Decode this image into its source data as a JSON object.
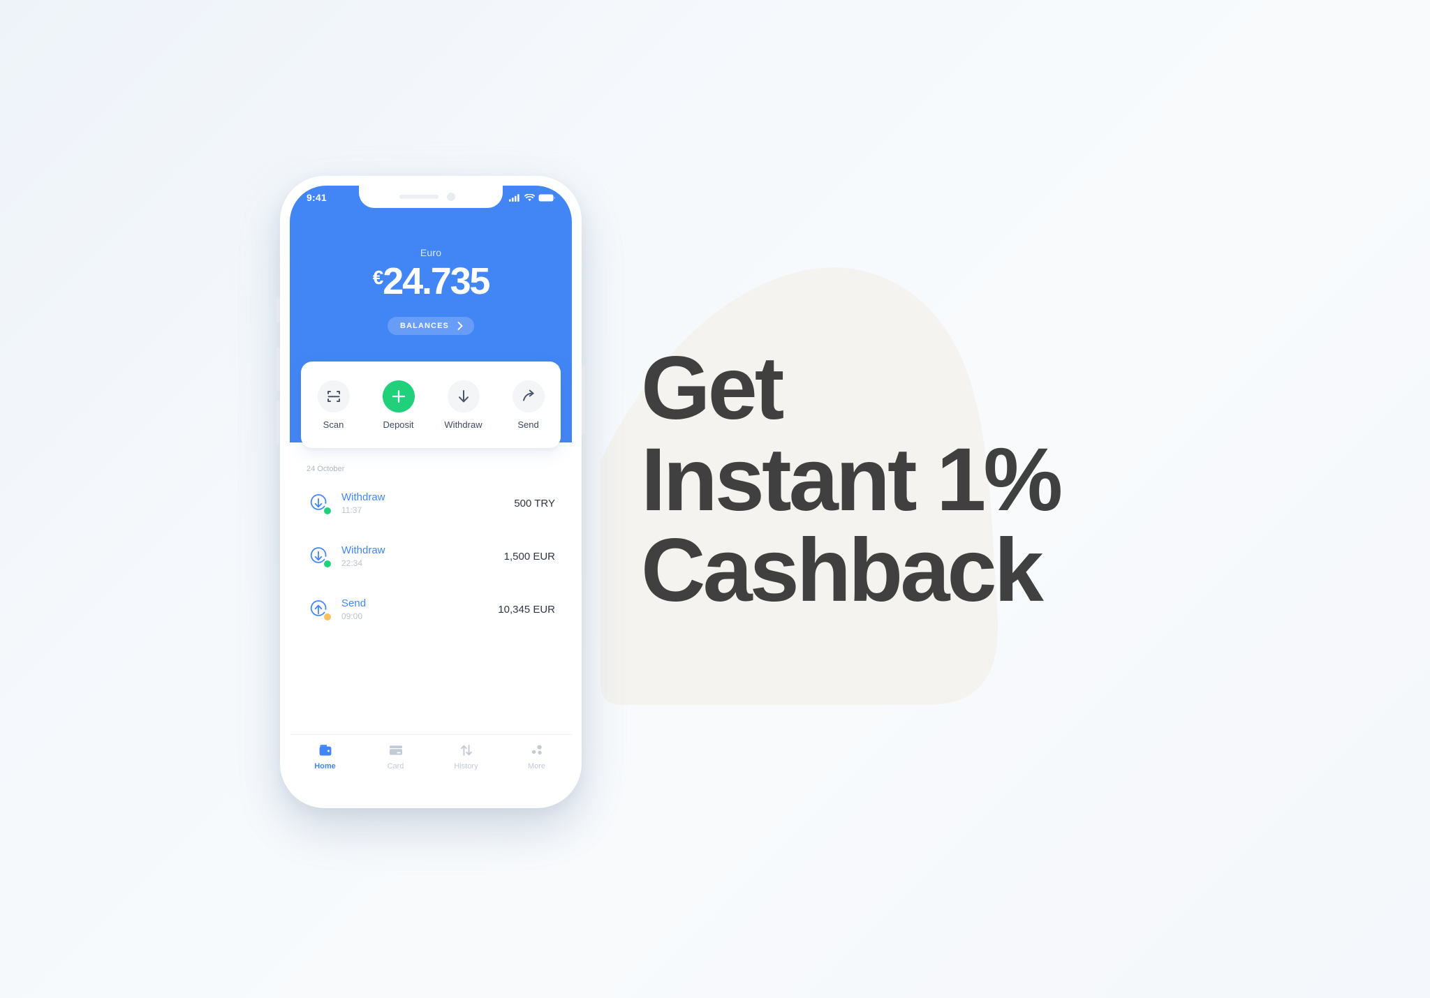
{
  "theme": {
    "brand_blue": "#4285f4",
    "accent_green": "#21d07a",
    "status_pending": "#f8c15c",
    "status_done": "#21d07a",
    "headline_color": "#404040",
    "blob_color": "#f4f3f0",
    "page_background": "#f5f8fb"
  },
  "phone": {
    "status_bar": {
      "time": "9:41",
      "icons": [
        "cellular-signal-icon",
        "wifi-icon",
        "battery-icon"
      ]
    },
    "header": {
      "currency_label": "Euro",
      "currency_symbol": "€",
      "balance_amount": "24.735",
      "balances_button": {
        "label": "BALANCES",
        "icon": "chevron-right-icon"
      }
    },
    "actions": [
      {
        "label": "Scan",
        "icon": "scan-icon",
        "style": "neutral"
      },
      {
        "label": "Deposit",
        "icon": "plus-icon",
        "style": "green"
      },
      {
        "label": "Withdraw",
        "icon": "arrow-down-icon",
        "style": "neutral"
      },
      {
        "label": "Send",
        "icon": "arrow-forward-icon",
        "style": "neutral"
      }
    ],
    "transactions": {
      "date_label": "24 October",
      "rows": [
        {
          "title": "Withdraw",
          "time": "11:37",
          "amount": "500 TRY",
          "direction": "in",
          "icon": "circle-arrow-down-icon",
          "status_color": "#21d07a"
        },
        {
          "title": "Withdraw",
          "time": "22:34",
          "amount": "1,500 EUR",
          "direction": "in",
          "icon": "circle-arrow-down-icon",
          "status_color": "#21d07a"
        },
        {
          "title": "Send",
          "time": "09:00",
          "amount": "10,345 EUR",
          "direction": "out",
          "icon": "circle-arrow-up-icon",
          "status_color": "#f8c15c"
        }
      ]
    },
    "tabs": [
      {
        "label": "Home",
        "icon": "wallet-icon",
        "active": true
      },
      {
        "label": "Card",
        "icon": "credit-card-icon",
        "active": false
      },
      {
        "label": "History",
        "icon": "exchange-arrows-icon",
        "active": false
      },
      {
        "label": "More",
        "icon": "dots-more-icon",
        "active": false
      }
    ]
  },
  "headline": {
    "line1": "Get",
    "line2": "Instant 1%",
    "line3": "Cashback"
  }
}
